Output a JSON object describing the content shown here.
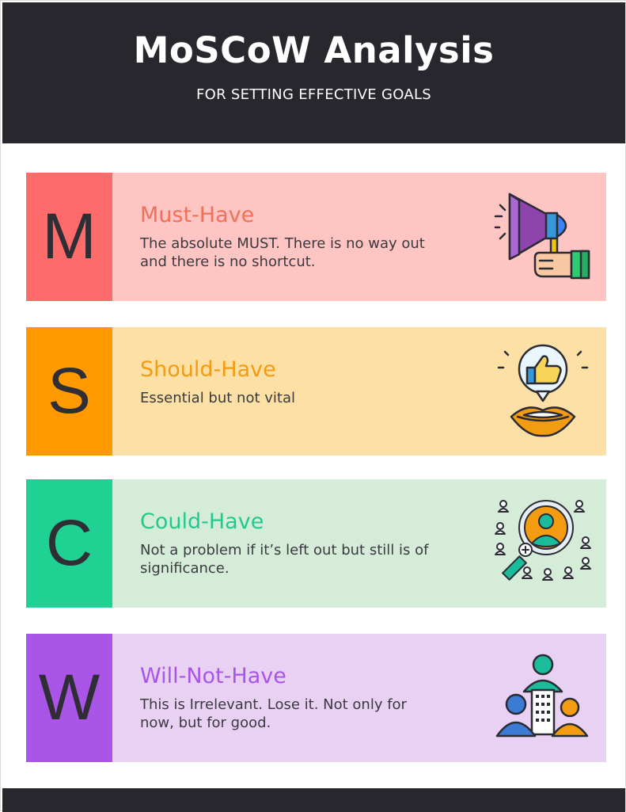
{
  "header": {
    "title": "MoSCoW Analysis",
    "subtitle": "FOR SETTING EFFECTIVE GOALS"
  },
  "rows": [
    {
      "letter": "M",
      "title": "Must-Have",
      "description": "The absolute MUST. There is no way out and there is no shortcut.",
      "icon": "megaphone-icon",
      "accent_color": "#ff6b6b",
      "title_color": "#f0705a",
      "background_color": "#ffc5c2"
    },
    {
      "letter": "S",
      "title": "Should-Have",
      "description": "Essential but not vital",
      "icon": "thumbs-up-speech-icon",
      "accent_color": "#ff9900",
      "title_color": "#f39c12",
      "background_color": "#fde0a6"
    },
    {
      "letter": "C",
      "title": "Could-Have",
      "description": "Not a problem if it’s left out but still is of significance.",
      "icon": "magnifier-people-icon",
      "accent_color": "#20d194",
      "title_color": "#22c98e",
      "background_color": "#d5edd8"
    },
    {
      "letter": "W",
      "title": "Will-Not-Have",
      "description": "This is Irrelevant. Lose it. Not only for now, but for good.",
      "icon": "team-building-icon",
      "accent_color": "#a855e8",
      "title_color": "#a855e8",
      "background_color": "#e9d1f3"
    }
  ]
}
